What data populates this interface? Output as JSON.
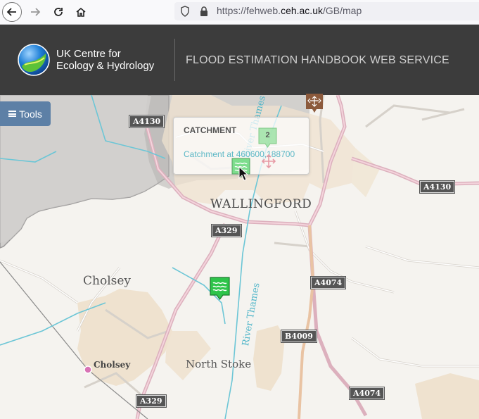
{
  "browser": {
    "url_prefix": "https://fehweb.",
    "url_domain": "ceh.ac.uk",
    "url_path": "/GB/map"
  },
  "header": {
    "org_line1": "UK Centre for",
    "org_line2": "Ecology & Hydrology",
    "service_title": "FLOOD ESTIMATION HANDBOOK WEB SERVICE"
  },
  "tools": {
    "label": "Tools"
  },
  "popup": {
    "title": "CATCHMENT",
    "link": "Catchment at 460600,188700"
  },
  "map": {
    "places": {
      "wallingford": "WALLINGFORD",
      "cholsey_town": "Cholsey",
      "cholsey_station": "Cholsey",
      "north_stoke": "North Stoke"
    },
    "rivers": {
      "thames_north": "River Thames",
      "thames_south": "River Thames"
    },
    "roads": {
      "a4130_west": "A4130",
      "a4130_east": "A4130",
      "a329_north": "A329",
      "a329_south": "A329",
      "a4074_north": "A4074",
      "a4074_south": "A4074",
      "b4009": "B4009"
    },
    "cluster_count": "2"
  },
  "colors": {
    "header_bg": "#3c3c3c",
    "tools_bg": "#5d80a6",
    "river": "#6cc6d6",
    "major_road": "#e6b3c2",
    "marker_green": "#2ec44a",
    "urban": "#efe2cf"
  }
}
